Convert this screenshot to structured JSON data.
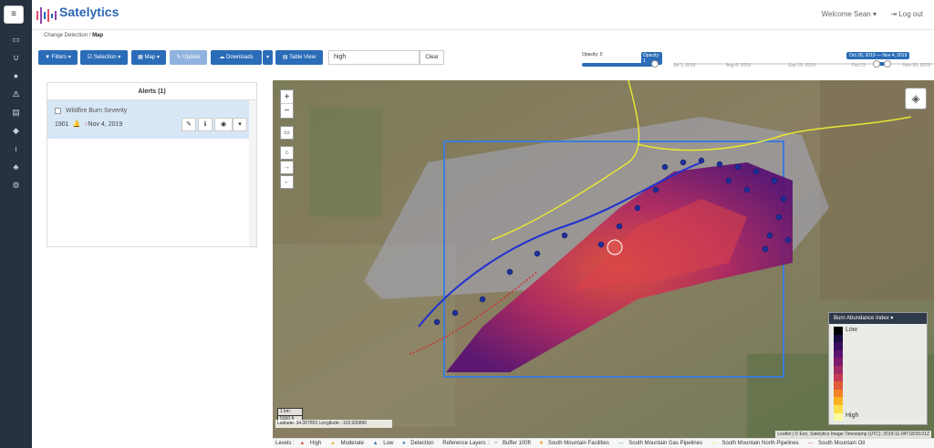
{
  "app": {
    "name": "Satelytics",
    "welcome": "Welcome Sean",
    "logout": "Log out"
  },
  "breadcrumb": {
    "parent": "Change Detection",
    "current": "Map"
  },
  "toolbar": {
    "filters": "Filters",
    "selection": "Selection",
    "map": "Map",
    "update": "Update",
    "downloads": "Downloads",
    "table_view": "Table View",
    "search_value": "high",
    "clear": "Clear"
  },
  "opacity": {
    "label": "Opacity: 0",
    "value_label": "Opacity: 1",
    "level": 1
  },
  "timeline": {
    "range": "Oct 28, 2019 — Nov 4, 2019",
    "ticks": [
      "Jul 1, 2019",
      "Aug 8, 2019",
      "Sep 15, 2019",
      "Oct 23",
      "Nov 30, 2019"
    ]
  },
  "alerts": {
    "title": "Alerts (1)",
    "items": [
      {
        "name": "Wildfire Burn Severity",
        "id": "1901",
        "date": "Nov 4, 2019"
      }
    ]
  },
  "map": {
    "legend_title": "Burn Abundance Index",
    "legend_low": "Low",
    "legend_high": "High",
    "legend_colors": [
      "#000000",
      "#1b0b3f",
      "#3a0b5e",
      "#5c126e",
      "#7d1a6c",
      "#a02a63",
      "#c23b52",
      "#e05a3a",
      "#f28224",
      "#fbb11f",
      "#fcdf4b",
      "#fbfb9d"
    ],
    "scale_km": "1 km",
    "scale_ft": "5000 ft",
    "coordinates": "Latitude: 34.307853 Longitude: -118.930896",
    "attribution": "Leaflet | © Esri, Satelytics Image Timestamp (UTC): 2019-11-04T18:55:01Z"
  },
  "layers_bar": {
    "levels": "Levels :",
    "high": "High",
    "moderate": "Moderate",
    "low": "Low",
    "detection": "Detection",
    "reference": "Reference Layers :",
    "buffer": "Buffer 100ft",
    "facilities": "South Mountain Facilities",
    "gas": "South Mountain Gas Pipelines",
    "north": "South Mountain North Pipelines",
    "oil": "South Mountain Oil"
  }
}
